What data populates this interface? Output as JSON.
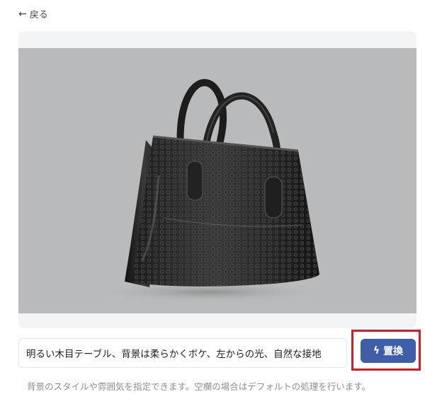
{
  "nav": {
    "back_label": "戻る"
  },
  "image": {
    "alt": "",
    "background_color": "#b9babb"
  },
  "prompt": {
    "value": "明るい木目テーブル、背景は柔らかくボケ、左からの光、自然な接地",
    "placeholder": ""
  },
  "actions": {
    "replace_label": "置換",
    "button_color": "#3f5ea9",
    "highlight_color": "#d51b2a"
  },
  "helper": {
    "text": "背景のスタイルや雰囲気を指定できます。空欄の場合はデフォルトの処理を行います。"
  }
}
